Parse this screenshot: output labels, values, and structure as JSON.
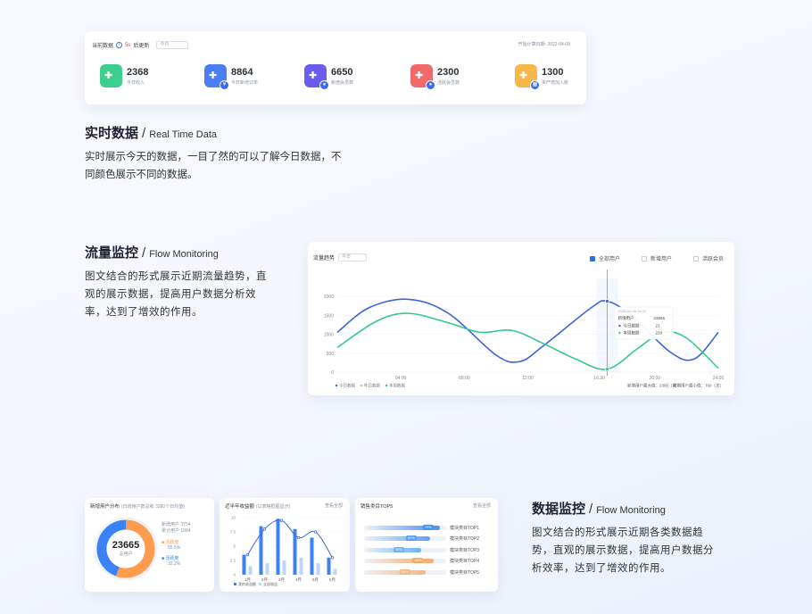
{
  "stats": {
    "label": "当前数据",
    "interval_value": "5s",
    "interval_unit": "后更新",
    "select_placeholder": "今日",
    "right_text": "开始计算日期: 2022-04-08",
    "items": [
      {
        "value": "2368",
        "label": "今日收入",
        "icon": "wallet-icon",
        "color": "#3ccf8e"
      },
      {
        "value": "8864",
        "label": "今日新增订单",
        "icon": "calendar-icon",
        "color": "#4b7df3"
      },
      {
        "value": "6650",
        "label": "新增会员数",
        "icon": "calendar-user-icon",
        "color": "#6b5cf0"
      },
      {
        "value": "2300",
        "label": "活跃会员数",
        "icon": "calendar-user-icon",
        "color": "#f06a6a"
      },
      {
        "value": "1300",
        "label": "资产增加入账",
        "icon": "wallet-icon",
        "color": "#f7b84b"
      }
    ]
  },
  "realtime": {
    "title": "实时数据",
    "title_en": "Real Time Data",
    "desc_line1": "实时展示今天的数据，一目了然的可以了解今日数据，不",
    "desc_line2": "同颜色展示不同的数据。"
  },
  "flow": {
    "title": "流量监控",
    "title_en": "Flow Monitoring",
    "desc_line1": "图文结合的形式展示近期流量趋势，直",
    "desc_line2": "观的展示数据，提高用户数据分析效",
    "desc_line3": "率，达到了增效的作用。"
  },
  "flow_chart": {
    "header": "流量趋势",
    "select_placeholder": "今日",
    "checks": [
      {
        "label": "全部用户",
        "checked": true
      },
      {
        "label": "新增用户",
        "checked": false
      },
      {
        "label": "活跃会员",
        "checked": false
      }
    ],
    "footer_left": [
      "今日数据",
      "昨日数据",
      "本周数据"
    ],
    "footer_right_1": "新增用户最大值：2300（次）",
    "footer_right_2": "新增用户最小值：760（次）",
    "tooltip": {
      "date": "2022-04-08 15:30",
      "header_label": "新增用户",
      "header_value": "23665",
      "row1_label": "今日数据",
      "row1_value": "21",
      "row2_label": "本周数据",
      "row2_value": "233"
    }
  },
  "chart_data": {
    "type": "line",
    "x_ticks": [
      "04:00",
      "08:00",
      "12:00",
      "16:30",
      "20:00",
      "24:00"
    ],
    "y_ticks": [
      "0",
      "500",
      "1000",
      "1500",
      "2000"
    ],
    "ylim": [
      0,
      2000
    ],
    "x_range": [
      0,
      24
    ],
    "series": [
      {
        "color": "#3a63e0",
        "points": [
          [
            0,
            1050
          ],
          [
            2,
            1700
          ],
          [
            4.5,
            1920
          ],
          [
            7,
            1550
          ],
          [
            10,
            450
          ],
          [
            11.5,
            280
          ],
          [
            13,
            700
          ],
          [
            16,
            1700
          ],
          [
            17,
            1870
          ],
          [
            18.5,
            1500
          ],
          [
            21,
            520
          ],
          [
            22.5,
            350
          ],
          [
            24,
            1050
          ]
        ]
      },
      {
        "color": "#34c98b",
        "points": [
          [
            0,
            650
          ],
          [
            2.5,
            1350
          ],
          [
            4.5,
            1550
          ],
          [
            7,
            1300
          ],
          [
            9,
            1050
          ],
          [
            11,
            1100
          ],
          [
            13,
            750
          ],
          [
            15,
            350
          ],
          [
            17,
            80
          ],
          [
            19,
            650
          ],
          [
            20.5,
            1050
          ],
          [
            22,
            900
          ],
          [
            24,
            100
          ]
        ]
      }
    ]
  },
  "datamon": {
    "title": "数据监控",
    "title_en": "Flow Monitoring",
    "desc_line1": "图文结合的形式展示近期各类数据趋",
    "desc_line2": "势，直观的展示数据，提高用户数据分",
    "desc_line3": "析效率，达到了增效的作用。"
  },
  "user_card": {
    "title": "新增用户分布",
    "subtitle": "(日增用户数总和 3280个日均值)",
    "total": "23665",
    "total_label": "总用户",
    "legend_top_1": "新增用户 3754",
    "legend_top_2": "累计用户 1084",
    "legend_a_label": "活跃度",
    "legend_a_value": "55.5%",
    "legend_b_label": "活跃度",
    "legend_b_value": "32.2%",
    "donut": [
      {
        "value": 55.5,
        "color": "#ff9b4d"
      },
      {
        "value": 44.5,
        "color": "#3b82f6"
      }
    ]
  },
  "half_card": {
    "title": "近半年收益额",
    "subtitle": "(以表格框图显示)",
    "right": "查看全部",
    "categories": [
      "1月",
      "2月",
      "3月",
      "4月",
      "5月",
      "6月"
    ],
    "y_ticks": [
      "0",
      "2.5",
      "5",
      "7.5",
      "10"
    ],
    "ylim": [
      0,
      10
    ],
    "bars_a": [
      3.5,
      8.5,
      9.8,
      8.0,
      6.5,
      3.0
    ],
    "bars_b": [
      1.5,
      2.0,
      2.5,
      3.0,
      2.0,
      1.0
    ],
    "line": [
      3.5,
      8.0,
      9.5,
      6.5,
      7.5,
      3.0
    ],
    "legend": [
      "我的收益额",
      "全部收益"
    ]
  },
  "top_card": {
    "title": "销售类目TOP5",
    "right": "查看全部",
    "items": [
      {
        "label": "模块类目TOP1",
        "fill": 0.92,
        "color": "#4a8df8",
        "tag": "76%"
      },
      {
        "label": "模块类目TOP2",
        "fill": 0.8,
        "color": "#5aa0f9",
        "tag": "62%"
      },
      {
        "label": "模块类目TOP3",
        "fill": 0.7,
        "color": "#6ab2fa",
        "tag": "55%"
      },
      {
        "label": "模块类目TOP4",
        "fill": 0.85,
        "color": "#f7a869",
        "tag": "48%"
      },
      {
        "label": "模块类目TOP5",
        "fill": 0.75,
        "color": "#f7b582",
        "tag": "36%"
      }
    ]
  }
}
